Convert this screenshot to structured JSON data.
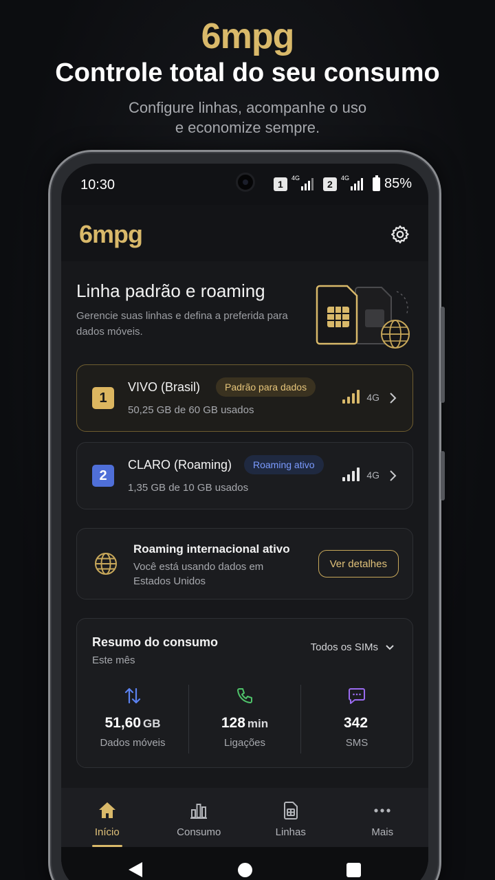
{
  "promo": {
    "logo": "6mpg",
    "title": "Controle total do seu consumo",
    "subtitle_line1": "Configure linhas, acompanhe o uso",
    "subtitle_line2": "e economize sempre."
  },
  "status_bar": {
    "time": "10:30",
    "sim1": "1",
    "sim2": "2",
    "network": "4G",
    "battery": "85%"
  },
  "app": {
    "logo": "6mpg"
  },
  "hero": {
    "title": "Linha padrão e roaming",
    "subtitle": "Gerencie suas linhas e defina a preferida para dados móveis."
  },
  "lines": [
    {
      "number": "1",
      "name": "VIVO (Brasil)",
      "badge": "Padrão para dados",
      "usage": "50,25 GB de 60 GB usados",
      "network": "4G",
      "color": "#dcb660"
    },
    {
      "number": "2",
      "name": "CLARO (Roaming)",
      "badge": "Roaming ativo",
      "usage": "1,35 GB de 10 GB usados",
      "network": "4G",
      "color": "#4f6fd8"
    }
  ],
  "roaming": {
    "title": "Roaming internacional ativo",
    "description": "Você está usando dados em Estados Unidos",
    "button": "Ver detalhes"
  },
  "summary": {
    "title": "Resumo do consumo",
    "period": "Este mês",
    "filter": "Todos os SIMs",
    "stats": [
      {
        "value": "51,60",
        "unit": "GB",
        "label": "Dados móveis",
        "icon": "data-transfer-icon"
      },
      {
        "value": "128",
        "unit": "min",
        "label": "Ligações",
        "icon": "phone-icon"
      },
      {
        "value": "342",
        "unit": "",
        "label": "SMS",
        "icon": "chat-icon"
      }
    ]
  },
  "bottom_nav": [
    {
      "label": "Início",
      "icon": "home-icon",
      "active": true
    },
    {
      "label": "Consumo",
      "icon": "bar-chart-icon"
    },
    {
      "label": "Linhas",
      "icon": "sim-card-icon"
    },
    {
      "label": "Mais",
      "icon": "more-icon"
    }
  ],
  "colors": {
    "accent": "#d9b96a",
    "roaming_blue": "#4f6fd8",
    "background": "#111215"
  }
}
